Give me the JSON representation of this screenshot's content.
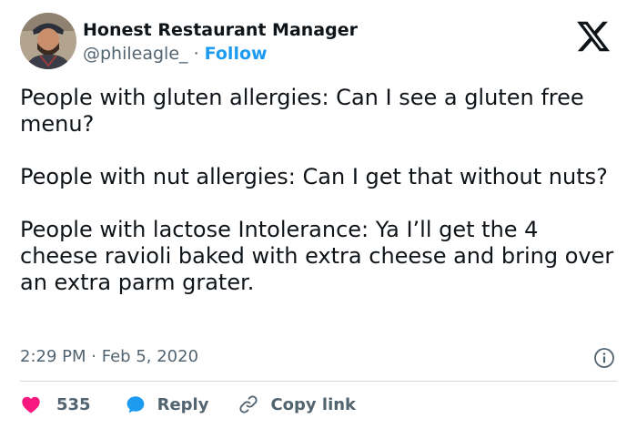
{
  "author": {
    "name": "Honest Restaurant Manager",
    "handle": "@phileagle_",
    "separator": "·",
    "follow_label": "Follow"
  },
  "tweet": {
    "paragraphs": [
      "People with gluten allergies: Can I see a gluten free menu?",
      "People with nut allergies: Can I get that without nuts?",
      "People with lactose Intolerance: Ya I’ll get the 4 cheese ravioli baked with extra cheese and bring over an extra parm grater."
    ],
    "time": "2:29 PM",
    "date_separator": "·",
    "date": "Feb 5, 2020"
  },
  "actions": {
    "likes": "535",
    "reply_label": "Reply",
    "copy_link_label": "Copy link"
  },
  "icons": {
    "brand": "x-logo",
    "info": "info-icon",
    "like": "heart-icon",
    "reply": "reply-bubble-icon",
    "copy": "link-icon"
  },
  "colors": {
    "text": "#0f1419",
    "secondary": "#536471",
    "accent": "#1d9bf0",
    "like": "#f91880",
    "divider": "#cfd9de"
  }
}
